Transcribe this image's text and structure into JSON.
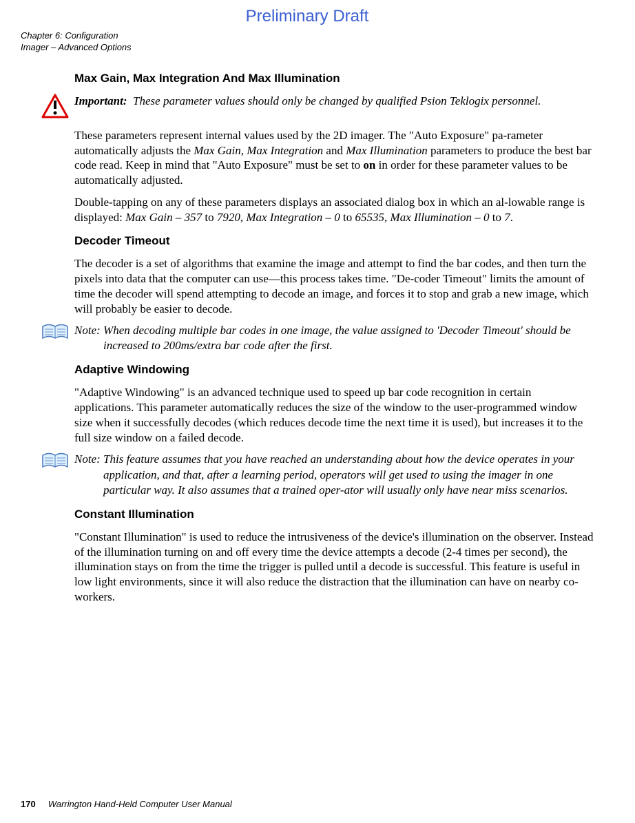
{
  "prelim": "Preliminary Draft",
  "header": {
    "line1": "Chapter 6: Configuration",
    "line2": "Imager – Advanced Options"
  },
  "section1": {
    "title": "Max Gain, Max Integration And Max Illumination"
  },
  "important": {
    "label": "Important:",
    "text": "These parameter values should only be changed by qualified Psion Teklogix personnel."
  },
  "p1a": "These parameters represent internal values used by the 2D imager. The \"Auto Exposure\" pa-rameter automatically adjusts the ",
  "p1b": "Max Gain, Max Integration",
  "p1c": " and ",
  "p1d": "Max Illumination",
  "p1e": " parameters to produce the best bar code read. Keep in mind that \"Auto Exposure\" must be set to ",
  "p1f": "on",
  "p1g": " in order for these parameter values to be automatically adjusted.",
  "p2a": "Double-tapping on any of these parameters displays an associated dialog box in which an al-lowable range is displayed: ",
  "p2b": "Max Gain – 357",
  "p2c": " to ",
  "p2d": "7920",
  "p2e": ", ",
  "p2f": "Max Integration – 0",
  "p2g": " to ",
  "p2h": "65535",
  "p2i": ", ",
  "p2j": "Max Illumination – 0",
  "p2k": " to ",
  "p2l": "7",
  "p2m": ".",
  "section2": {
    "title": "Decoder Timeout"
  },
  "p3": "The decoder is a set of algorithms that examine the image and attempt to find the bar codes, and then turn the pixels into data that the computer can use—this process takes time. \"De-coder Timeout\" limits the amount of time the decoder will spend attempting to decode an image, and forces it to stop and grab a new image, which will probably be easier to decode.",
  "note1": {
    "label": "Note:",
    "text": "When decoding multiple bar codes in one image, the value assigned to 'Decoder Timeout' should be increased to 200ms/extra bar code after the first."
  },
  "section3": {
    "title": "Adaptive Windowing"
  },
  "p4": "\"Adaptive Windowing\" is an advanced technique used to speed up bar code recognition in certain applications. This parameter automatically reduces the size of the window to the user-programmed window size when it successfully decodes (which reduces decode time the next time it is used), but increases it to the full size window on a failed decode.",
  "note2": {
    "label": "Note:",
    "text": "This feature assumes that you have reached an understanding about how the device operates in your application, and that, after a learning period, operators will get used to using the imager in one particular way. It also assumes that a trained oper-ator will usually only have near miss scenarios."
  },
  "section4": {
    "title": "Constant Illumination"
  },
  "p5": "\"Constant Illumination\" is used to reduce the intrusiveness of the device's illumination on the observer. Instead of the illumination turning on and off every time the device attempts a decode (2-4 times per second), the illumination stays on from the time the trigger is pulled until a decode is successful. This feature is useful in low light environments, since it will also reduce the distraction that the illumination can have on nearby co-workers.",
  "footer": {
    "page": "170",
    "title": "Warrington Hand-Held Computer User Manual"
  }
}
